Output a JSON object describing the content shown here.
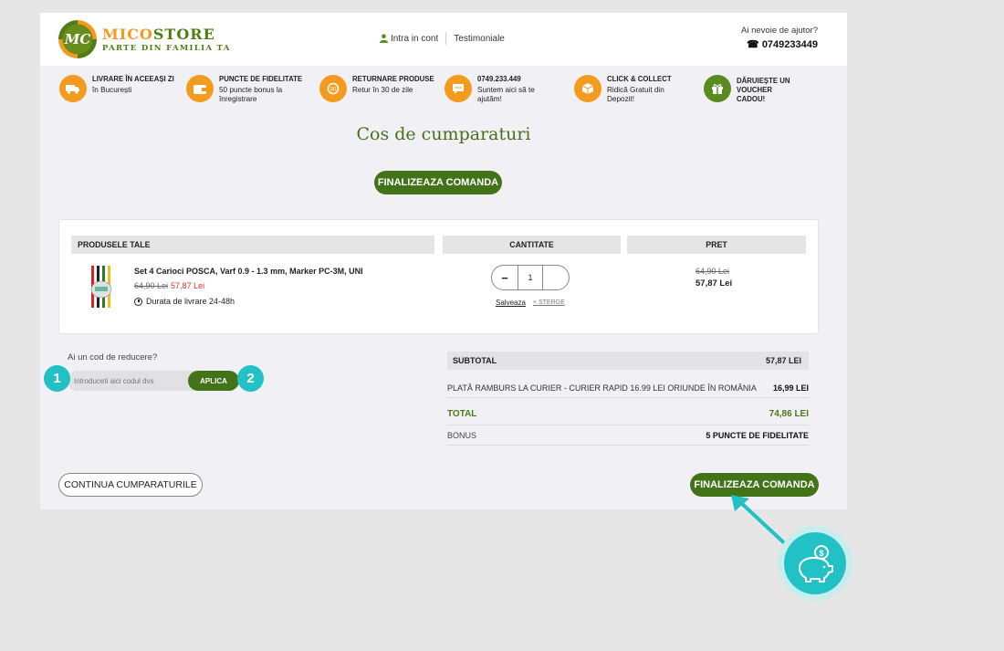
{
  "header": {
    "logo_mark": "MC",
    "logo_name_a": "MICO",
    "logo_name_b": "STORE",
    "logo_tagline": "PARTE DIN FAMILIA TA",
    "login": "Intra in cont",
    "testimonials": "Testimoniale",
    "help_question": "Ai nevoie de ajutor?",
    "help_phone": "0749233449"
  },
  "benefits": [
    {
      "title": "LIVRARE ÎN ACEEAȘI ZI",
      "text": "în București",
      "icon": "truck-icon"
    },
    {
      "title": "PUNCTE DE FIDELITATE",
      "text": "50 puncte bonus la înregistrare",
      "icon": "wallet-icon"
    },
    {
      "title": "RETURNARE PRODUSE",
      "text": "Retur în 30 de zile",
      "icon": "return-icon"
    },
    {
      "title": "0749.233.449",
      "text": "Suntem aici să te ajutăm!",
      "icon": "chat-icon"
    },
    {
      "title": "CLICK & COLLECT",
      "text": "Ridică Gratuit din Depozit!",
      "icon": "box-icon"
    },
    {
      "title": "DĂRUIEȘTE UN VOUCHER CADOU!",
      "text": "",
      "icon": "gift-icon"
    }
  ],
  "page_title": "Cos de cumparaturi",
  "checkout_label": "FINALIZEAZA COMANDA",
  "cart": {
    "col_products": "PRODUSELE TALE",
    "col_qty": "CANTITATE",
    "col_price": "PRET",
    "item": {
      "name": "Set 4 Carioci POSCA, Varf 0.9 - 1.3 mm, Marker PC-3M, UNI",
      "old_price": "64,90 Lei",
      "new_price": "57,87 Lei",
      "delivery": "Durata de livrare 24-48h",
      "quantity": "1",
      "minus": "−",
      "save": "Salveaza",
      "delete": "× STERGE",
      "price_old": "64,90 Lei",
      "price_new": "57,87 Lei"
    }
  },
  "coupon": {
    "label": "Ai un cod de reducere?",
    "placeholder": "Introduceti aici codul dvs",
    "apply": "APLICA",
    "badge_1": "1",
    "badge_2": "2"
  },
  "summary": {
    "subtotal_label": "SUBTOTAL",
    "subtotal_value": "57,87 LEI",
    "shipping_label": "PLATĂ RAMBURS LA CURIER - CURIER RAPID 16.99 LEI ORIUNDE ÎN ROMÂNIA",
    "shipping_value": "16,99 LEI",
    "total_label": "TOTAL",
    "total_value": "74,86 LEI",
    "bonus_label": "BONUS",
    "bonus_value": "5 PUNCTE DE FIDELITATE"
  },
  "continue_label": "CONTINUA CUMPARATURILE",
  "colors": {
    "brand_green": "#437318",
    "brand_orange": "#f29b1e",
    "annotation_teal": "#21c1c5"
  }
}
